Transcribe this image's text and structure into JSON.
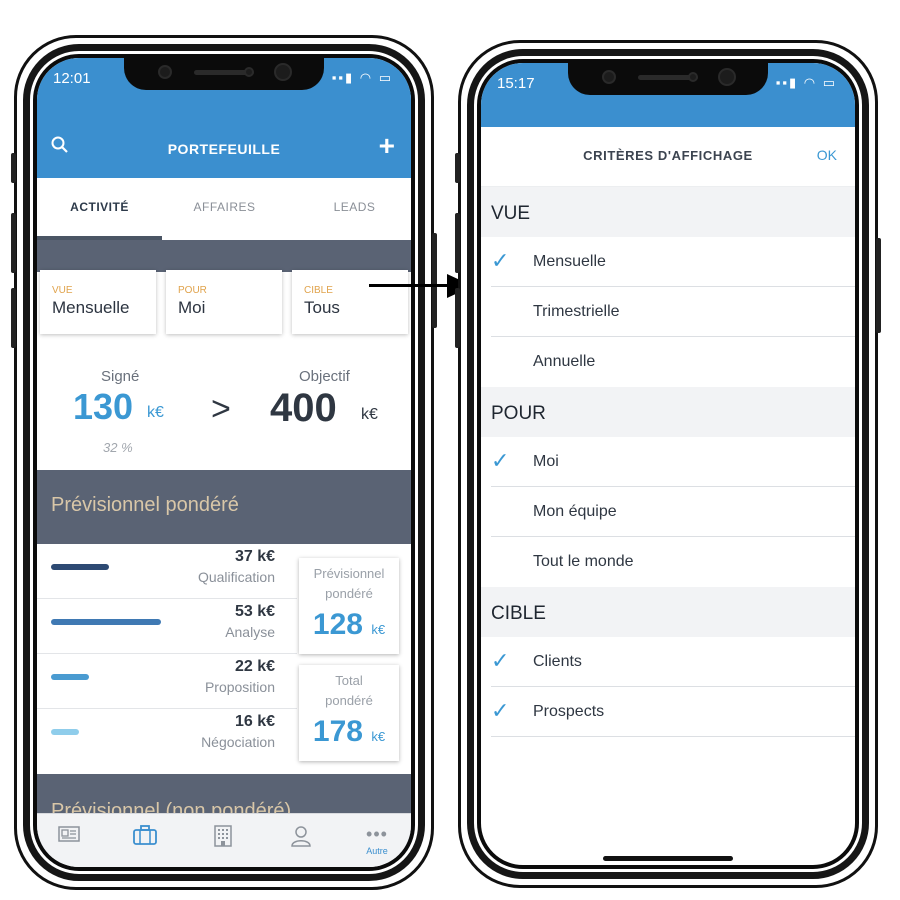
{
  "left_phone": {
    "status": {
      "time": "12:01"
    },
    "nav": {
      "title": "PORTEFEUILLE"
    },
    "tabs": [
      {
        "label": "ACTIVITÉ",
        "active": true
      },
      {
        "label": "AFFAIRES",
        "active": false
      },
      {
        "label": "LEADS",
        "active": false
      }
    ],
    "selectors": [
      {
        "caption": "VUE",
        "value": "Mensuelle"
      },
      {
        "caption": "POUR",
        "value": "Moi"
      },
      {
        "caption": "CIBLE",
        "value": "Tous"
      }
    ],
    "kpi": {
      "signed_label": "Signé",
      "signed_value": "130",
      "signed_unit": "k€",
      "signed_pct": "32 %",
      "separator": ">",
      "objective_label": "Objectif",
      "objective_value": "400",
      "objective_unit": "k€"
    },
    "weighted_section": {
      "title": "Prévisionnel pondéré"
    },
    "stages": [
      {
        "amount": "37 k€",
        "name": "Qualification",
        "color": "#2d4a73",
        "bar_fraction": 0.5
      },
      {
        "amount": "53 k€",
        "name": "Analyse",
        "color": "#3f79b3",
        "bar_fraction": 0.95
      },
      {
        "amount": "22 k€",
        "name": "Proposition",
        "color": "#4a9bd1",
        "bar_fraction": 0.33
      },
      {
        "amount": "16 k€",
        "name": "Négociation",
        "color": "#8fcdeb",
        "bar_fraction": 0.24
      }
    ],
    "cards": [
      {
        "label_line1": "Prévisionnel",
        "label_line2": "pondéré",
        "value": "128",
        "unit": "k€"
      },
      {
        "label_line1": "Total",
        "label_line2": "pondéré",
        "value": "178",
        "unit": "k€"
      }
    ],
    "unweighted_section": {
      "title": "Prévisionnel (non pondéré)"
    },
    "tabbar": {
      "more_label": "Autre"
    },
    "accent_color": "#3b8fcf"
  },
  "right_phone": {
    "status": {
      "time": "15:17"
    },
    "nav": {
      "title": "CRITÈRES D'AFFICHAGE",
      "ok_label": "OK"
    },
    "sections": [
      {
        "title": "VUE",
        "options": [
          {
            "label": "Mensuelle",
            "checked": true
          },
          {
            "label": "Trimestrielle",
            "checked": false
          },
          {
            "label": "Annuelle",
            "checked": false
          }
        ]
      },
      {
        "title": "POUR",
        "options": [
          {
            "label": "Moi",
            "checked": true
          },
          {
            "label": "Mon équipe",
            "checked": false
          },
          {
            "label": "Tout le monde",
            "checked": false
          }
        ]
      },
      {
        "title": "CIBLE",
        "options": [
          {
            "label": "Clients",
            "checked": true
          },
          {
            "label": "Prospects",
            "checked": true
          }
        ]
      }
    ]
  },
  "icons": [
    "search-icon",
    "plus-icon",
    "newspaper-icon",
    "briefcase-icon",
    "building-icon",
    "user-icon",
    "more-icon",
    "checkmark-icon",
    "arrow-right-icon"
  ]
}
